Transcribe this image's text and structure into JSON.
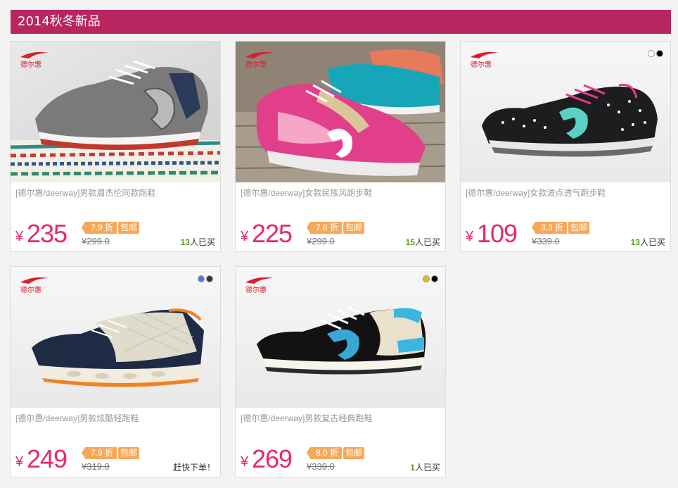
{
  "section": {
    "title": "2014秋冬新品"
  },
  "brand": {
    "logo_text": "德尔惠",
    "accent": "#e8286a",
    "bar_color": "#b7265f",
    "discount_color": "#f6a95a"
  },
  "products": [
    {
      "title": "[德尔惠/deerway]男款周杰伦同款跑鞋",
      "currency": "¥",
      "price": "235",
      "discount": "7.9 折",
      "free_shipping": "包邮",
      "original_price": "¥299.0",
      "sold_count": "13",
      "sold_suffix": "人已买",
      "image": "grey-mens-running-shoe-on-knit-photo"
    },
    {
      "title": "[德尔惠/deerway]女款民族风跑步鞋",
      "currency": "¥",
      "price": "225",
      "discount": "7.6 折",
      "free_shipping": "包邮",
      "original_price": "¥299.0",
      "sold_count": "15",
      "sold_suffix": "人已买",
      "image": "pink-womens-ethnic-shoes-photo"
    },
    {
      "title": "[德尔惠/deerway]女款波点透气跑步鞋",
      "currency": "¥",
      "price": "109",
      "discount": "3.3 折",
      "free_shipping": "包邮",
      "original_price": "¥339.0",
      "sold_count": "13",
      "sold_suffix": "人已买",
      "image": "black-polka-dot-shoe",
      "color_options": [
        "#ffffff",
        "#000000"
      ]
    },
    {
      "title": "[德尔惠/deerway]男款炫酷轻跑鞋",
      "currency": "¥",
      "price": "249",
      "discount": "7.9 折",
      "free_shipping": "包邮",
      "original_price": "¥319.0",
      "sold_label": "赶快下单！",
      "image": "navy-beige-light-runner-shoe",
      "color_options": [
        "#4a7fd6",
        "#333333"
      ]
    },
    {
      "title": "[德尔惠/deerway]男款复古经典跑鞋",
      "currency": "¥",
      "price": "269",
      "discount": "8.0 折",
      "free_shipping": "包邮",
      "original_price": "¥339.0",
      "sold_count": "1",
      "sold_suffix": "人已买",
      "image": "black-beige-retro-classic-shoe",
      "color_options": [
        "#e8b82a",
        "#000000"
      ]
    }
  ]
}
